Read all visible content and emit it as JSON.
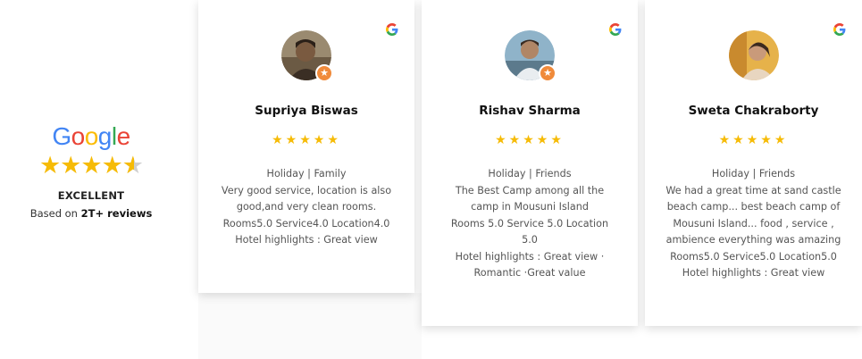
{
  "summary": {
    "brand_letters": [
      "G",
      "o",
      "o",
      "g",
      "l",
      "e"
    ],
    "brand_colors": [
      "#4285F4",
      "#EA4335",
      "#FBBC05",
      "#4285F4",
      "#34A853",
      "#EA4335"
    ],
    "rating_fraction": 0.9,
    "rating_word": "EXCELLENT",
    "based_prefix": "Based on ",
    "based_count": "2T+ reviews"
  },
  "reviews": [
    {
      "name": "Supriya Biswas",
      "stars": "★★★★★",
      "text": [
        "Holiday | Family",
        "Very good service, location is also",
        "good,and very clean rooms.",
        "Rooms5.0 Service4.0 Location4.0",
        "Hotel highlights : Great view"
      ],
      "avatar_colors": [
        "#9a8a70",
        "#5a4634"
      ],
      "source_icon": "google-g-icon"
    },
    {
      "name": "Rishav Sharma",
      "stars": "★★★★★",
      "text": [
        "Holiday | Friends",
        "The Best Camp among all the",
        "camp in Mousuni Island",
        "Rooms 5.0 Service 5.0 Location",
        "5.0",
        "Hotel highlights : Great view ·",
        "Romantic ·Great value"
      ],
      "avatar_colors": [
        "#8fb3c9",
        "#4a6070"
      ],
      "source_icon": "google-g-icon"
    },
    {
      "name": "Sweta Chakraborty",
      "stars": "★★★★★",
      "text": [
        "Holiday | Friends",
        "We had a great time at sand castle",
        "beach camp... best beach camp of",
        "Mousuni Island... food , service ,",
        "ambience everything was amazing",
        "Rooms5.0 Service5.0 Location5.0",
        "Hotel highlights : Great view"
      ],
      "avatar_colors": [
        "#e6b24a",
        "#7c6a4e"
      ],
      "source_icon": "google-g-icon"
    }
  ],
  "colors": {
    "star": "#f6bb06",
    "badge": "#f08a3a"
  }
}
